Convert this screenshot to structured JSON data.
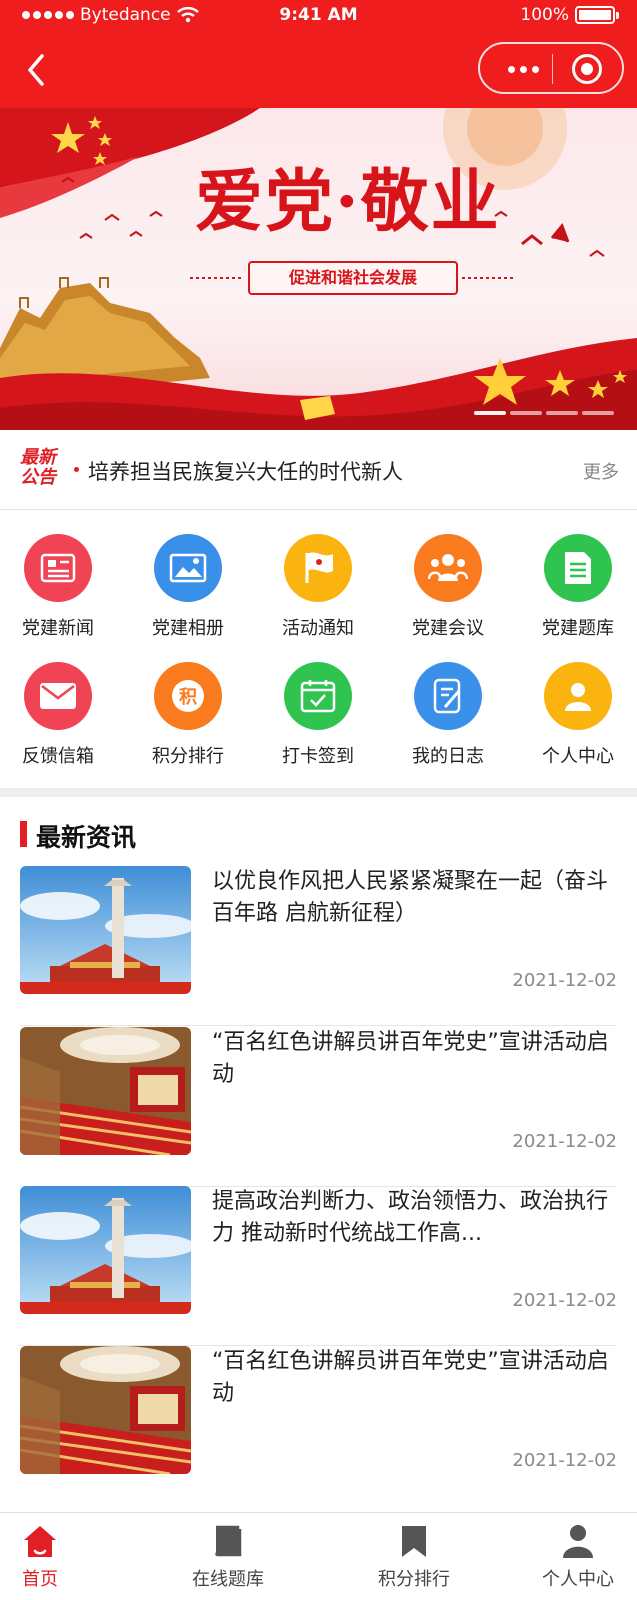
{
  "status_bar": {
    "carrier": "Bytedance",
    "time": "9:41 AM",
    "battery": "100%"
  },
  "nav": {
    "back_icon": "chevron-left-icon",
    "more_icon": "more-dots-icon",
    "close_icon": "target-close-icon"
  },
  "banner": {
    "title": "爱党·敬业",
    "slogan": "促进和谐社会发展",
    "slide_count": 4
  },
  "notice": {
    "badge": "最新公告",
    "text": "培养担当民族复兴大任的时代新人",
    "more": "更多"
  },
  "grid": [
    {
      "label": "党建新闻",
      "icon": "newspaper-icon",
      "color": "#f04354"
    },
    {
      "label": "党建相册",
      "icon": "photo-album-icon",
      "color": "#3a8fe8"
    },
    {
      "label": "活动通知",
      "icon": "party-flag-icon",
      "color": "#fbb40f"
    },
    {
      "label": "党建会议",
      "icon": "meeting-icon",
      "color": "#fa7a1e"
    },
    {
      "label": "党建题库",
      "icon": "document-icon",
      "color": "#2fc44f"
    },
    {
      "label": "反馈信箱",
      "icon": "mail-icon",
      "color": "#f04354"
    },
    {
      "label": "积分排行",
      "icon": "points-icon",
      "color": "#fa7a1e"
    },
    {
      "label": "打卡签到",
      "icon": "calendar-check-icon",
      "color": "#2fc44f"
    },
    {
      "label": "我的日志",
      "icon": "notebook-icon",
      "color": "#3a8fe8"
    },
    {
      "label": "个人中心",
      "icon": "user-icon",
      "color": "#fbb40f"
    }
  ],
  "news_section": {
    "title": "最新资讯",
    "items": [
      {
        "title": "以优良作风把人民紧紧凝聚在一起（奋斗百年路 启航新征程）",
        "date": "2021-12-02",
        "image": "tiananmen"
      },
      {
        "title": "“百名红色讲解员讲百年党史”宣讲活动启动",
        "date": "2021-12-02",
        "image": "auditorium"
      },
      {
        "title": "提高政治判断力、政治领悟力、政治执行力 推动新时代统战工作高...",
        "date": "2021-12-02",
        "image": "tiananmen"
      },
      {
        "title": "“百名红色讲解员讲百年党史”宣讲活动启动",
        "date": "2021-12-02",
        "image": "auditorium"
      }
    ]
  },
  "tabbar": [
    {
      "label": "首页",
      "icon": "home-icon",
      "active": true
    },
    {
      "label": "在线题库",
      "icon": "book-icon",
      "active": false
    },
    {
      "label": "积分排行",
      "icon": "bookmark-icon",
      "active": false
    },
    {
      "label": "个人中心",
      "icon": "person-icon",
      "active": false
    }
  ],
  "colors": {
    "primary": "#ef1d1d",
    "accent": "#e11f24"
  }
}
